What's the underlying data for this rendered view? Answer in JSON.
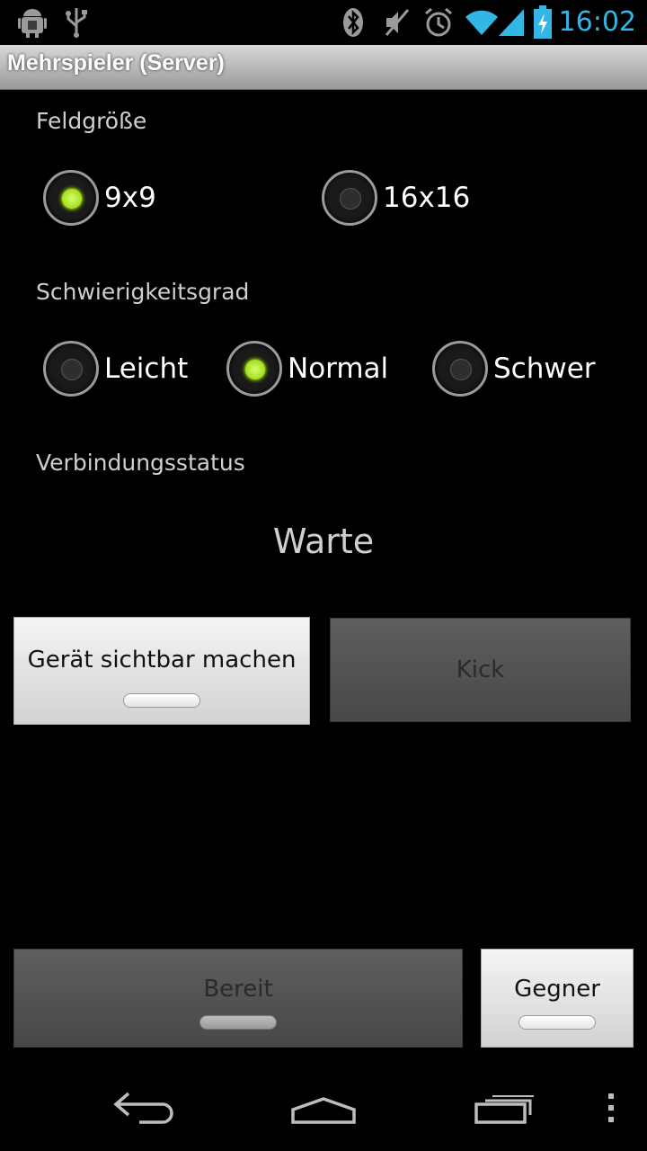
{
  "status_bar": {
    "time": "16:02",
    "icons": [
      "android-debug-icon",
      "usb-icon",
      "bluetooth-icon",
      "mute-icon",
      "alarm-icon",
      "wifi-icon",
      "signal-icon",
      "battery-charging-icon"
    ]
  },
  "title_bar": {
    "title": "Mehrspieler (Server)"
  },
  "field_size": {
    "label": "Feldgröße",
    "options": [
      {
        "label": "9x9",
        "checked": true
      },
      {
        "label": "16x16",
        "checked": false
      }
    ]
  },
  "difficulty": {
    "label": "Schwierigkeitsgrad",
    "options": [
      {
        "label": "Leicht",
        "checked": false
      },
      {
        "label": "Normal",
        "checked": true
      },
      {
        "label": "Schwer",
        "checked": false
      }
    ]
  },
  "connection": {
    "label": "Verbindungsstatus",
    "value": "Warte"
  },
  "buttons": {
    "make_visible": "Gerät sichtbar machen",
    "kick": "Kick",
    "ready": "Bereit",
    "opponent": "Gegner"
  },
  "nav_bar": {
    "icons": [
      "back-icon",
      "home-icon",
      "recent-apps-icon",
      "overflow-menu-icon"
    ]
  },
  "colors": {
    "accent": "#33b5e5",
    "radio_checked": "#9fdf00"
  }
}
